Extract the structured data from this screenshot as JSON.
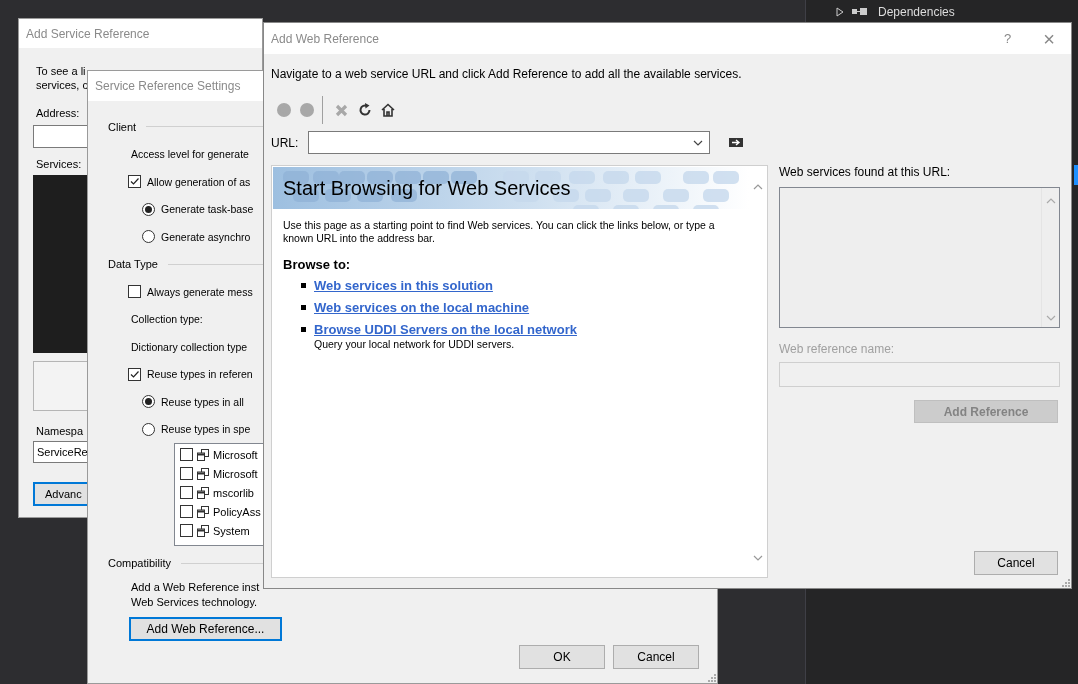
{
  "ide": {
    "tree_item": {
      "label": "Dependencies",
      "expanded": false
    }
  },
  "add_service_reference": {
    "title": "Add Service Reference",
    "intro_lines": [
      "To see a li",
      "services, c"
    ],
    "address_label": "Address:",
    "services_label": "Services:",
    "namespace_label": "Namespa",
    "namespace_value": "ServiceRe",
    "advanced_button": {
      "label": "Advanc",
      "focused": true
    }
  },
  "settings": {
    "title": "Service Reference Settings",
    "rows": [
      {
        "kind": "group",
        "label": "Client"
      },
      {
        "kind": "label",
        "label": "Access level for generate"
      },
      {
        "kind": "checkbox",
        "label": "Allow generation of as",
        "checked": true
      },
      {
        "kind": "radio",
        "label": "Generate task-base",
        "selected": true
      },
      {
        "kind": "radio",
        "label": "Generate asynchro",
        "selected": false
      },
      {
        "kind": "group",
        "label": "Data Type"
      },
      {
        "kind": "checkbox",
        "label": "Always generate mess",
        "checked": false
      },
      {
        "kind": "label",
        "label": "Collection type:"
      },
      {
        "kind": "label",
        "label": "Dictionary collection type"
      },
      {
        "kind": "checkbox",
        "label": "Reuse types in referen",
        "checked": true
      },
      {
        "kind": "radio",
        "label": "Reuse types in all",
        "selected": true
      },
      {
        "kind": "radio",
        "label": "Reuse types in spe",
        "selected": false
      }
    ],
    "assemblies": [
      {
        "name": "Microsoft",
        "checked": false
      },
      {
        "name": "Microsoft",
        "checked": false
      },
      {
        "name": "mscorlib",
        "checked": false
      },
      {
        "name": "PolicyAss",
        "checked": false
      },
      {
        "name": "System",
        "checked": false
      }
    ],
    "compatibility": {
      "header": "Compatibility",
      "lines": [
        "Add a Web Reference inst",
        "Web Services technology."
      ],
      "button": {
        "label": "Add Web Reference...",
        "focused": true
      }
    },
    "buttons": [
      "OK",
      "Cancel"
    ]
  },
  "add_web_reference": {
    "title": "Add Web Reference",
    "help": "?",
    "close": "×",
    "instruction": "Navigate to a web service URL and click Add Reference to add all the available services.",
    "toolbar": [
      {
        "disabled": true
      },
      {
        "disabled": true
      },
      {
        "disabled": true
      },
      {
        "disabled": false
      },
      {
        "disabled": false
      }
    ],
    "url_label": "URL:",
    "browser": {
      "heading": "Start Browsing for Web Services",
      "intro": "Use this page as a starting point to find Web services. You can click the links below, or type a known URL into the address bar.",
      "browse_to": "Browse to:",
      "links": [
        {
          "text": "Web services in this solution"
        },
        {
          "text": "Web services on the local machine"
        },
        {
          "text": "Browse UDDI Servers on the local network",
          "description": "Query your local network for UDDI servers."
        }
      ]
    },
    "found_label": "Web services found at this URL:",
    "name_label": "Web reference name:",
    "name_disabled": true,
    "add_button": {
      "label": "Add Reference",
      "disabled": true
    },
    "cancel_button": "Cancel"
  }
}
